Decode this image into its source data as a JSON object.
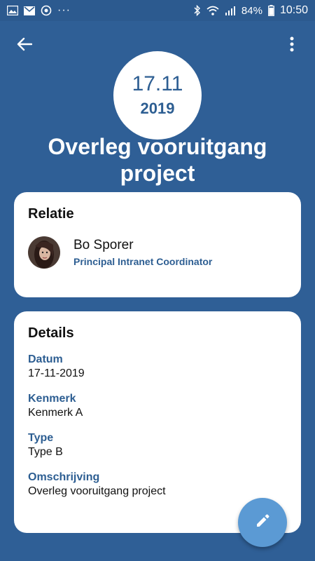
{
  "status_bar": {
    "dots": "···",
    "battery_percent": "84%",
    "time": "10:50"
  },
  "header": {
    "date_day": "17.11",
    "date_year": "2019",
    "title": "Overleg vooruitgang project"
  },
  "relatie": {
    "title": "Relatie",
    "name": "Bo Sporer",
    "role": "Principal Intranet Coordinator"
  },
  "details": {
    "title": "Details",
    "fields": [
      {
        "label": "Datum",
        "value": "17-11-2019"
      },
      {
        "label": "Kenmerk",
        "value": "Kenmerk A"
      },
      {
        "label": "Type",
        "value": "Type B"
      },
      {
        "label": "Omschrijving",
        "value": "Overleg vooruitgang project"
      }
    ]
  },
  "icons": {
    "back": "arrow-back-icon",
    "more": "more-vert-icon",
    "edit": "pencil-icon"
  },
  "colors": {
    "background": "#2f5f96",
    "accent": "#2d5e92",
    "fab": "#5b9ad4"
  }
}
